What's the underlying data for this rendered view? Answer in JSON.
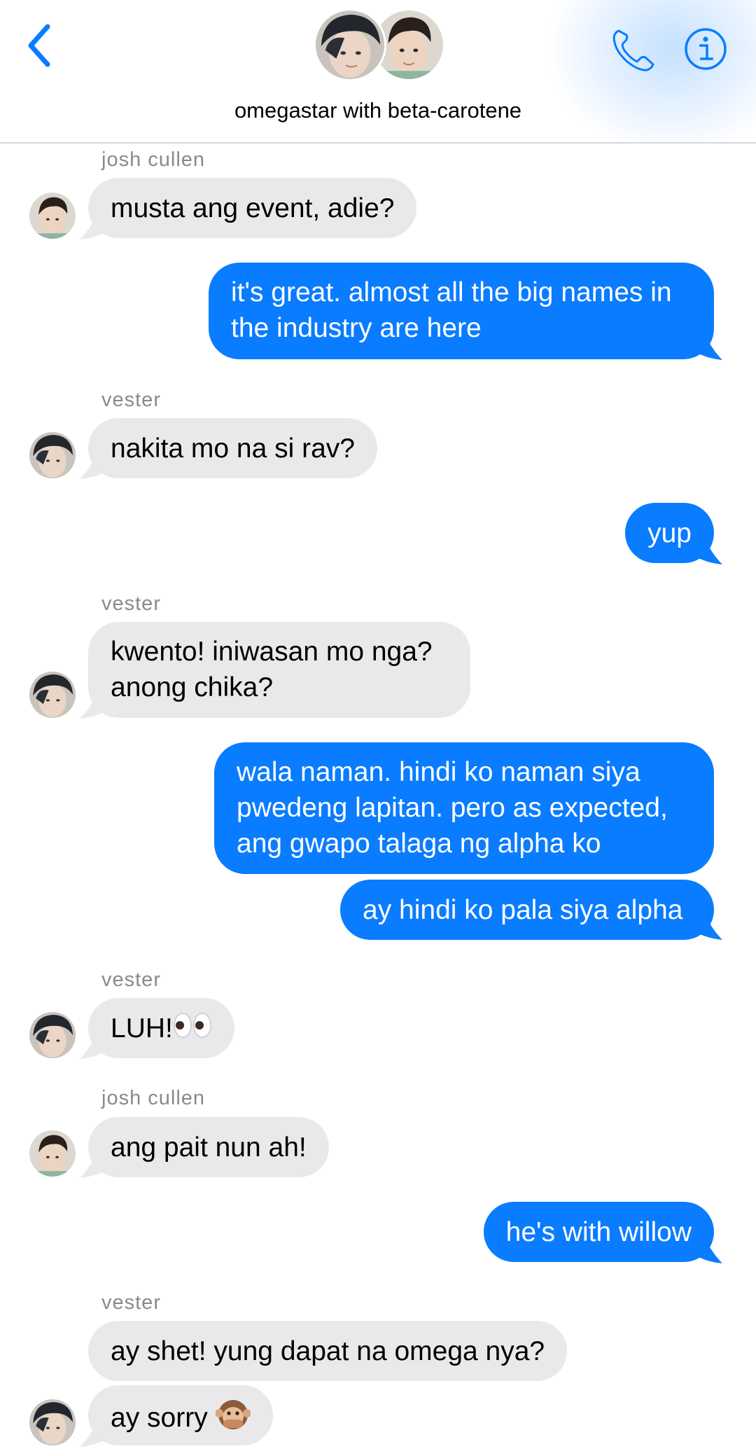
{
  "header": {
    "chat_title": "omegastar with beta-carotene",
    "back_icon": "chevron-left-icon",
    "call_icon": "phone-icon",
    "info_icon": "info-icon",
    "accent_color": "#0a7cff"
  },
  "messages": [
    {
      "sender": "josh cullen",
      "text": "musta ang event, adie?",
      "direction": "incoming"
    },
    {
      "text": "it's great. almost all the big names in\nthe industry are here",
      "direction": "outgoing"
    },
    {
      "sender": "vester",
      "text": "nakita mo na si rav?",
      "direction": "incoming"
    },
    {
      "text": "yup",
      "direction": "outgoing"
    },
    {
      "sender": "vester",
      "text": "kwento! iniwasan mo nga?\nanong chika?",
      "direction": "incoming"
    },
    {
      "text": "wala naman. hindi ko naman siya\npwedeng lapitan. pero as expected,\nang gwapo talaga ng alpha ko",
      "direction": "outgoing"
    },
    {
      "text": "ay hindi ko pala siya alpha",
      "direction": "outgoing"
    },
    {
      "sender": "vester",
      "text": "LUH!",
      "emoji": "eyes-emoji",
      "direction": "incoming"
    },
    {
      "sender": "josh cullen",
      "text": "ang pait nun ah!",
      "direction": "incoming"
    },
    {
      "text": "he's with willow",
      "direction": "outgoing"
    },
    {
      "sender": "vester",
      "text": "ay shet! yung dapat na omega nya?",
      "direction": "incoming"
    },
    {
      "text": "ay sorry",
      "emoji": "speak-no-evil-monkey-emoji",
      "direction": "incoming"
    }
  ]
}
